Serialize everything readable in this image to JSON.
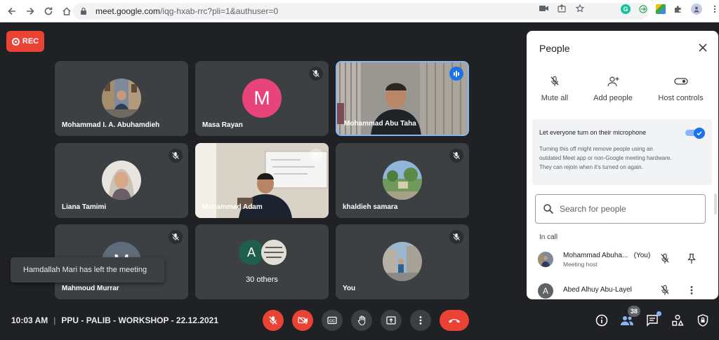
{
  "browser": {
    "url_host": "meet.google.com",
    "url_path": "/iqg-hxab-rrc?pli=1&authuser=0"
  },
  "recording": {
    "label": "REC"
  },
  "tiles": [
    {
      "name": "Mohammad I. A. Abuhamdieh"
    },
    {
      "name": "Masa Rayan",
      "initial": "M"
    },
    {
      "name": "Mohammad Abu Taha"
    },
    {
      "name": "Liana Tamimi"
    },
    {
      "name": "Mohammad Adam"
    },
    {
      "name": "khaldieh samara"
    },
    {
      "name": "Mahmoud Murrar",
      "initial": "M"
    },
    {
      "name": "30 others",
      "initial": "A"
    },
    {
      "name": "You"
    }
  ],
  "toast": {
    "text": "Hamdallah Mari has left the meeting"
  },
  "meeting": {
    "time": "10:03 AM",
    "separator": "|",
    "title": "PPU - PALIB - WORKSHOP - 22.12.2021"
  },
  "controls": {
    "people_count": "38"
  },
  "people_panel": {
    "title": "People",
    "actions": {
      "mute_all": "Mute all",
      "add_people": "Add people",
      "host_controls": "Host controls"
    },
    "mic_setting": {
      "label": "Let everyone turn on their microphone",
      "enabled": true,
      "help": "Turning this off might remove people using an outdated Meet app or non-Google meeting hardware. They can rejoin when it's turned on again."
    },
    "search": {
      "placeholder": "Search for people"
    },
    "section_label": "In call",
    "participants": [
      {
        "name": "Mohammad Abuha...",
        "suffix": "(You)",
        "role": "Meeting host"
      },
      {
        "name": "Abed Alhuy Abu-Layel",
        "initial": "A"
      }
    ]
  }
}
